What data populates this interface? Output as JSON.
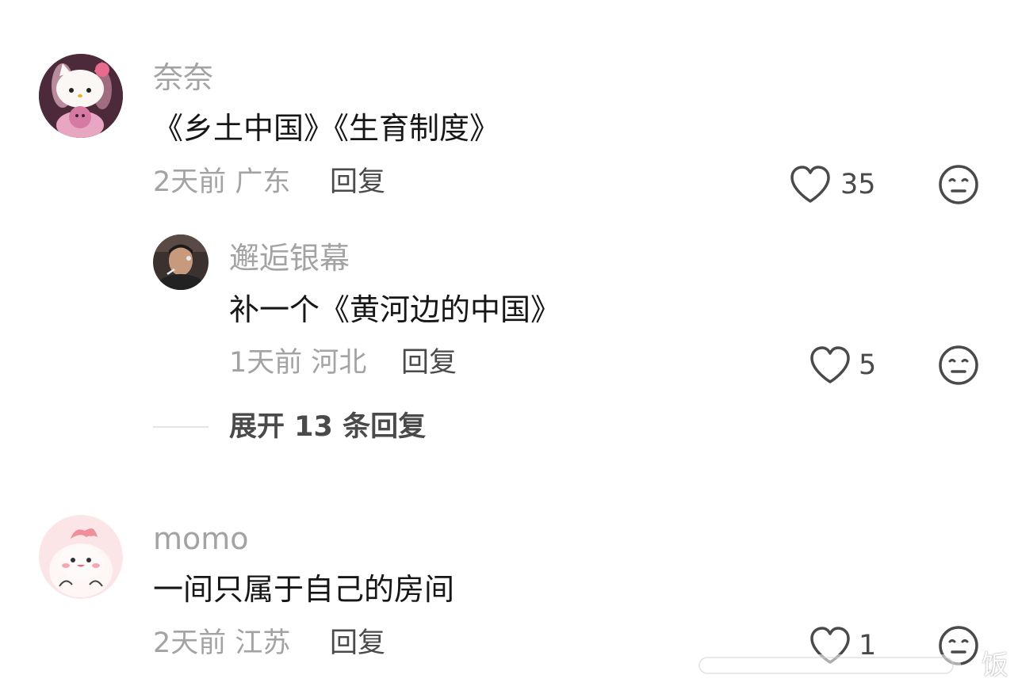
{
  "comments": [
    {
      "username": "奈奈",
      "content": "《乡土中国》《生育制度》",
      "meta": "2天前 广东",
      "reply_label": "回复",
      "like_count": "35",
      "avatar_icon": "hello-kitty-avatar",
      "reply": {
        "username": "邂逅银幕",
        "content": "补一个《黄河边的中国》",
        "meta": "1天前 河北",
        "reply_label": "回复",
        "like_count": "5",
        "avatar_icon": "person-smoking-avatar"
      },
      "expand_label": "展开 13 条回复"
    },
    {
      "username": "momo",
      "content": "一间只属于自己的房间",
      "meta": "2天前 江苏",
      "reply_label": "回复",
      "like_count": "1",
      "avatar_icon": "pink-cartoon-avatar"
    }
  ],
  "icons": {
    "like": "heart-outline-icon",
    "dislike": "meh-face-icon"
  },
  "watermark": "饭",
  "colors": {
    "username": "#a3a3a3",
    "content": "#161616",
    "action": "#4a4a4a"
  }
}
